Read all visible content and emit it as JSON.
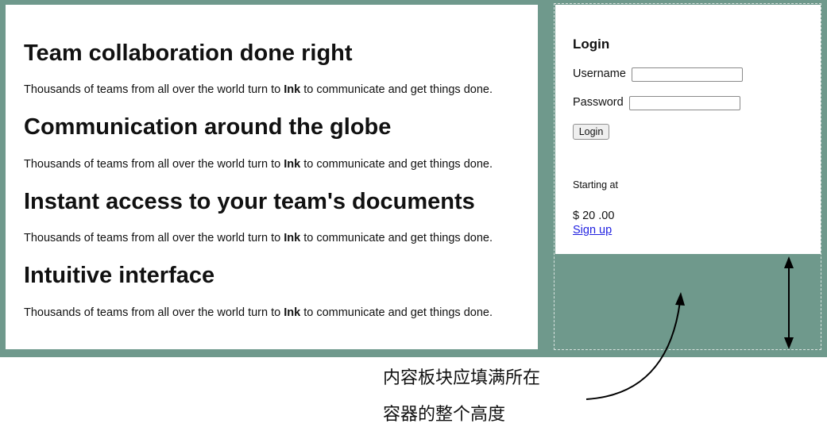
{
  "features": [
    {
      "heading": "Team collaboration done right",
      "text_before": "Thousands of teams from all over the world turn to ",
      "brand": "Ink",
      "text_after": " to communicate and get things done."
    },
    {
      "heading": "Communication around the globe",
      "text_before": "Thousands of teams from all over the world turn to ",
      "brand": "Ink",
      "text_after": " to communicate and get things done."
    },
    {
      "heading": "Instant access to your team's documents",
      "text_before": "Thousands of teams from all over the world turn to ",
      "brand": "Ink",
      "text_after": " to communicate and get things done."
    },
    {
      "heading": "Intuitive interface",
      "text_before": "Thousands of teams from all over the world turn to ",
      "brand": "Ink",
      "text_after": " to communicate and get things done."
    }
  ],
  "sidebar": {
    "login_title": "Login",
    "username_label": "Username",
    "username_value": "",
    "password_label": "Password",
    "password_value": "",
    "login_button": "Login",
    "starting_at": "Starting at",
    "price": "$ 20 .00",
    "signup_link": "Sign up"
  },
  "annotation": {
    "line1": "内容板块应填满所在",
    "line2": "容器的整个高度"
  },
  "colors": {
    "background": "#6f998c",
    "panel": "#ffffff",
    "link": "#1f1fe0",
    "dashed_outline": "#d8e2de"
  }
}
